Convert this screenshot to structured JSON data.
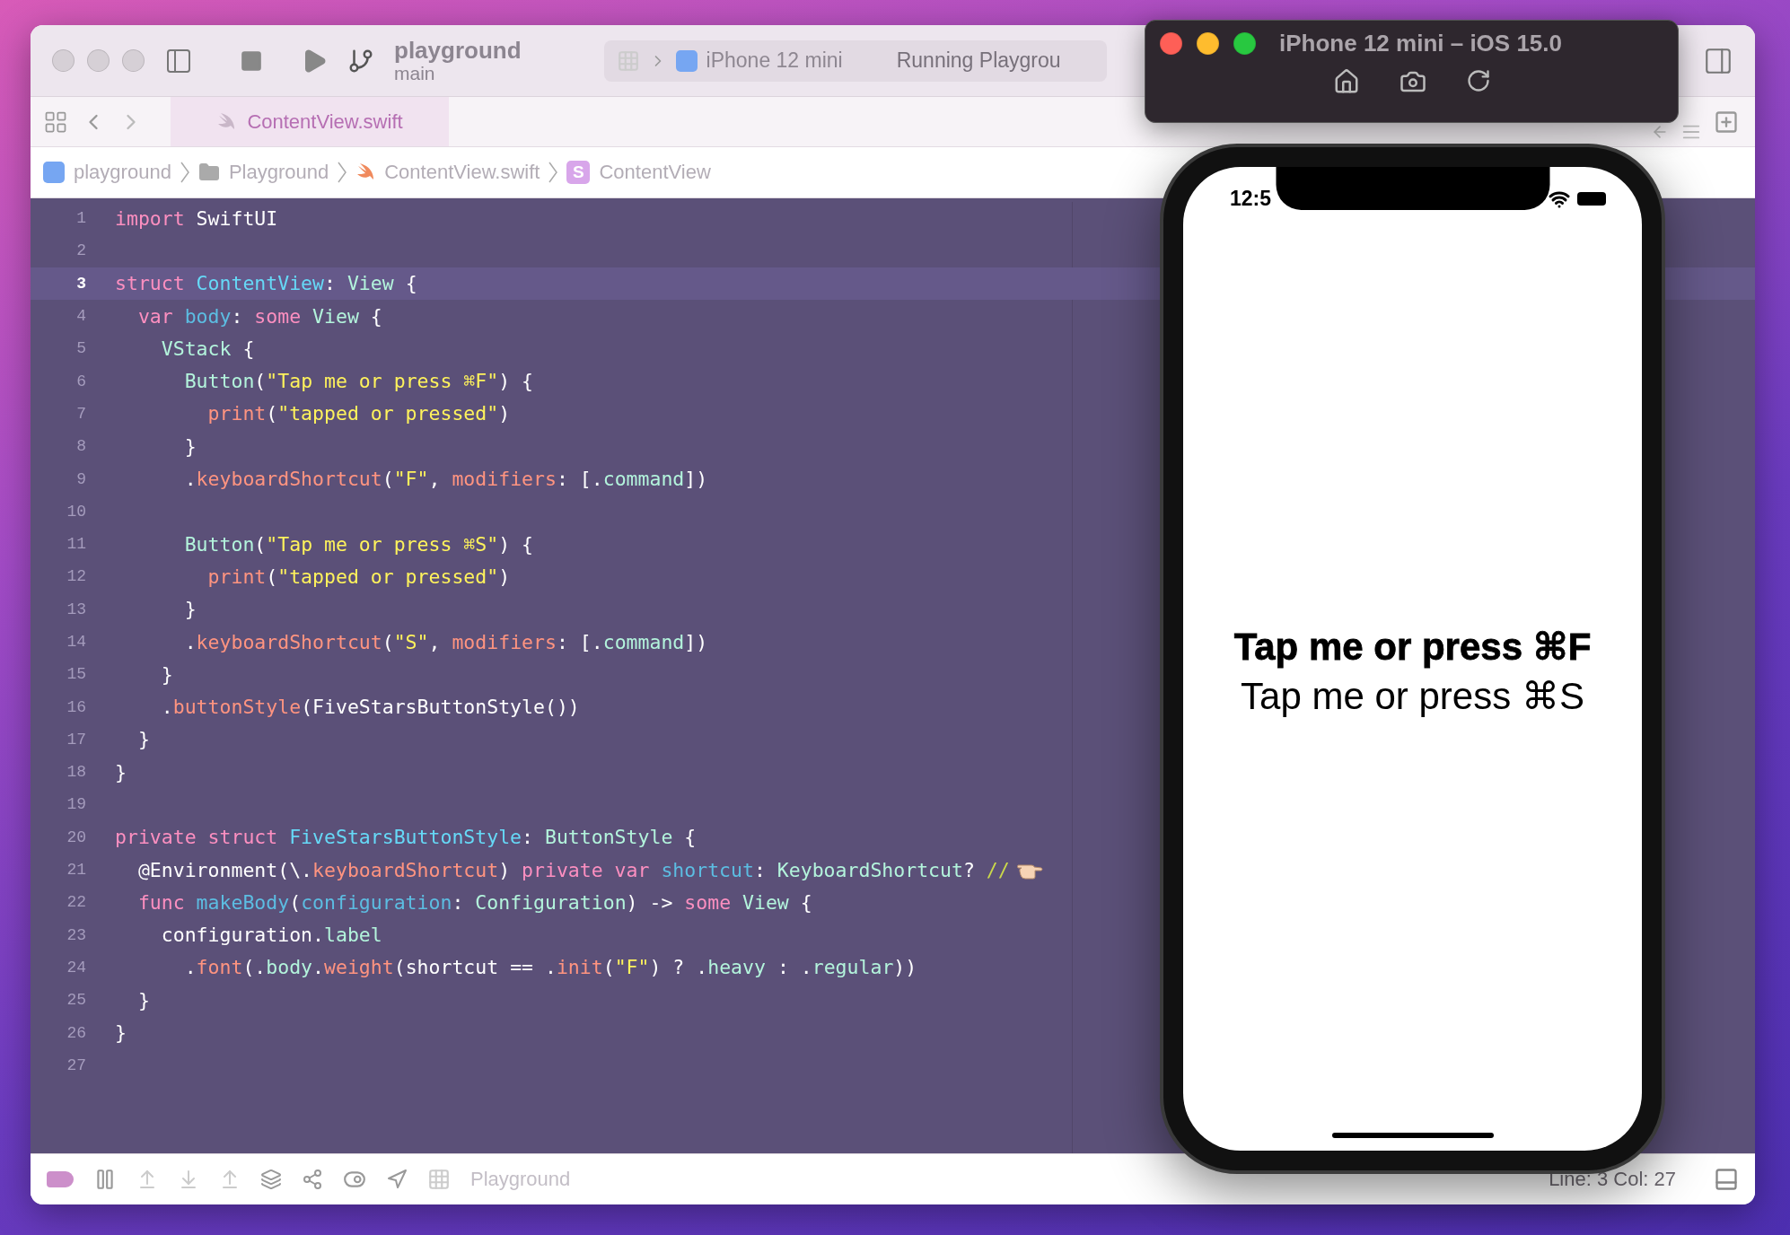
{
  "toolbar": {
    "project": "playground",
    "branch": "main",
    "scheme_device": "iPhone 12 mini",
    "activity": "Running Playgrou"
  },
  "tabs": [
    {
      "label": "ContentView.swift",
      "selected": true
    }
  ],
  "jump_bar": [
    {
      "kind": "app",
      "label": "playground"
    },
    {
      "kind": "folder",
      "label": "Playground"
    },
    {
      "kind": "swift",
      "label": "ContentView.swift"
    },
    {
      "kind": "struct",
      "label": "ContentView",
      "badge": "S"
    }
  ],
  "editor": {
    "lines": [
      {
        "number": "1",
        "current": false,
        "tokens": [
          {
            "kind": "keyword",
            "t": "import"
          },
          {
            "kind": "plain",
            "t": " SwiftUI"
          }
        ]
      },
      {
        "number": "2",
        "current": false
      },
      {
        "number": "3",
        "current": true,
        "tokens": [
          {
            "kind": "keyword",
            "t": "struct"
          },
          {
            "kind": "decl",
            "t": " ContentView"
          },
          {
            "kind": "plain",
            "t": ": "
          },
          {
            "kind": "type",
            "t": "View"
          },
          {
            "kind": "plain",
            "t": " {"
          }
        ]
      },
      {
        "number": "4",
        "current": false,
        "tokens": [
          {
            "kind": "keyword",
            "t": "  var"
          },
          {
            "kind": "ident",
            "t": " body"
          },
          {
            "kind": "plain",
            "t": ": "
          },
          {
            "kind": "keyword",
            "t": "some"
          },
          {
            "kind": "type",
            "t": " View"
          },
          {
            "kind": "plain",
            "t": " {"
          }
        ]
      },
      {
        "number": "5",
        "current": false,
        "tokens": [
          {
            "kind": "type",
            "t": "    VStack"
          },
          {
            "kind": "plain",
            "t": " {"
          }
        ]
      },
      {
        "number": "6",
        "current": false,
        "tokens": [
          {
            "kind": "type",
            "t": "      Button"
          },
          {
            "kind": "plain",
            "t": "("
          },
          {
            "kind": "string",
            "t": "\"Tap me or press ⌘F\""
          },
          {
            "kind": "plain",
            "t": ") {"
          }
        ]
      },
      {
        "number": "7",
        "current": false,
        "tokens": [
          {
            "kind": "call",
            "t": "        print"
          },
          {
            "kind": "plain",
            "t": "("
          },
          {
            "kind": "string",
            "t": "\"tapped or pressed\""
          },
          {
            "kind": "plain",
            "t": ")"
          }
        ]
      },
      {
        "number": "8",
        "current": false,
        "tokens": [
          {
            "kind": "plain",
            "t": "      }"
          }
        ]
      },
      {
        "number": "9",
        "current": false,
        "tokens": [
          {
            "kind": "plain",
            "t": "      ."
          },
          {
            "kind": "call",
            "t": "keyboardShortcut"
          },
          {
            "kind": "plain",
            "t": "("
          },
          {
            "kind": "string",
            "t": "\"F\""
          },
          {
            "kind": "plain",
            "t": ", "
          },
          {
            "kind": "call",
            "t": "modifiers"
          },
          {
            "kind": "plain",
            "t": ": [."
          },
          {
            "kind": "type",
            "t": "command"
          },
          {
            "kind": "plain",
            "t": "])"
          }
        ]
      },
      {
        "number": "10",
        "current": false
      },
      {
        "number": "11",
        "current": false,
        "tokens": [
          {
            "kind": "type",
            "t": "      Button"
          },
          {
            "kind": "plain",
            "t": "("
          },
          {
            "kind": "string",
            "t": "\"Tap me or press ⌘S\""
          },
          {
            "kind": "plain",
            "t": ") {"
          }
        ]
      },
      {
        "number": "12",
        "current": false,
        "tokens": [
          {
            "kind": "call",
            "t": "        print"
          },
          {
            "kind": "plain",
            "t": "("
          },
          {
            "kind": "string",
            "t": "\"tapped or pressed\""
          },
          {
            "kind": "plain",
            "t": ")"
          }
        ]
      },
      {
        "number": "13",
        "current": false,
        "tokens": [
          {
            "kind": "plain",
            "t": "      }"
          }
        ]
      },
      {
        "number": "14",
        "current": false,
        "tokens": [
          {
            "kind": "plain",
            "t": "      ."
          },
          {
            "kind": "call",
            "t": "keyboardShortcut"
          },
          {
            "kind": "plain",
            "t": "("
          },
          {
            "kind": "string",
            "t": "\"S\""
          },
          {
            "kind": "plain",
            "t": ", "
          },
          {
            "kind": "call",
            "t": "modifiers"
          },
          {
            "kind": "plain",
            "t": ": [."
          },
          {
            "kind": "type",
            "t": "command"
          },
          {
            "kind": "plain",
            "t": "])"
          }
        ]
      },
      {
        "number": "15",
        "current": false,
        "tokens": [
          {
            "kind": "plain",
            "t": "    }"
          }
        ]
      },
      {
        "number": "16",
        "current": false,
        "tokens": [
          {
            "kind": "plain",
            "t": "    ."
          },
          {
            "kind": "call",
            "t": "buttonStyle"
          },
          {
            "kind": "plain",
            "t": "(FiveStarsButtonStyle())"
          }
        ]
      },
      {
        "number": "17",
        "current": false,
        "tokens": [
          {
            "kind": "plain",
            "t": "  }"
          }
        ]
      },
      {
        "number": "18",
        "current": false,
        "tokens": [
          {
            "kind": "plain",
            "t": "}"
          }
        ]
      },
      {
        "number": "19",
        "current": false
      },
      {
        "number": "20",
        "current": false,
        "tokens": [
          {
            "kind": "keyword",
            "t": "private struct"
          },
          {
            "kind": "decl",
            "t": " FiveStarsButtonStyle"
          },
          {
            "kind": "plain",
            "t": ": "
          },
          {
            "kind": "type",
            "t": "ButtonStyle"
          },
          {
            "kind": "plain",
            "t": " {"
          }
        ]
      },
      {
        "number": "21",
        "current": false,
        "kind": "pointing-hand",
        "tokens": [
          {
            "kind": "plain",
            "t": "  @Environment(\\."
          },
          {
            "kind": "call",
            "t": "keyboardShortcut"
          },
          {
            "kind": "plain",
            "t": ") "
          },
          {
            "kind": "keyword",
            "t": "private var"
          },
          {
            "kind": "ident",
            "t": " shortcut"
          },
          {
            "kind": "plain",
            "t": ": "
          },
          {
            "kind": "type",
            "t": "KeyboardShortcut"
          },
          {
            "kind": "plain",
            "t": "? "
          },
          {
            "kind": "comment",
            "t": "//"
          }
        ]
      },
      {
        "number": "22",
        "current": false,
        "tokens": [
          {
            "kind": "keyword",
            "t": "  func"
          },
          {
            "kind": "ident",
            "t": " makeBody"
          },
          {
            "kind": "plain",
            "t": "("
          },
          {
            "kind": "ident",
            "t": "configuration"
          },
          {
            "kind": "plain",
            "t": ": "
          },
          {
            "kind": "type",
            "t": "Configuration"
          },
          {
            "kind": "plain",
            "t": ") -> "
          },
          {
            "kind": "keyword",
            "t": "some"
          },
          {
            "kind": "type",
            "t": " View"
          },
          {
            "kind": "plain",
            "t": " {"
          }
        ]
      },
      {
        "number": "23",
        "current": false,
        "tokens": [
          {
            "kind": "plain",
            "t": "    configuration."
          },
          {
            "kind": "type",
            "t": "label"
          }
        ]
      },
      {
        "number": "24",
        "current": false,
        "tokens": [
          {
            "kind": "plain",
            "t": "      ."
          },
          {
            "kind": "call",
            "t": "font"
          },
          {
            "kind": "plain",
            "t": "(."
          },
          {
            "kind": "type",
            "t": "body"
          },
          {
            "kind": "plain",
            "t": "."
          },
          {
            "kind": "call",
            "t": "weight"
          },
          {
            "kind": "plain",
            "t": "(shortcut == ."
          },
          {
            "kind": "call",
            "t": "init"
          },
          {
            "kind": "plain",
            "t": "("
          },
          {
            "kind": "string",
            "t": "\"F\""
          },
          {
            "kind": "plain",
            "t": ") ? ."
          },
          {
            "kind": "type",
            "t": "heavy"
          },
          {
            "kind": "plain",
            "t": " : ."
          },
          {
            "kind": "type",
            "t": "regular"
          },
          {
            "kind": "plain",
            "t": "))"
          }
        ]
      },
      {
        "number": "25",
        "current": false,
        "tokens": [
          {
            "kind": "plain",
            "t": "  }"
          }
        ]
      },
      {
        "number": "26",
        "current": false,
        "tokens": [
          {
            "kind": "plain",
            "t": "}"
          }
        ]
      },
      {
        "number": "27",
        "current": false
      }
    ]
  },
  "debug_bar": {
    "target": "Playground",
    "position": "Line: 3  Col: 27"
  },
  "simulator": {
    "title": "iPhone 12 mini – iOS 15.0",
    "time": "12:5",
    "buttons": [
      {
        "label": "Tap me or press ⌘F",
        "heavy": true
      },
      {
        "label": "Tap me or press ⌘S",
        "heavy": false
      }
    ]
  }
}
